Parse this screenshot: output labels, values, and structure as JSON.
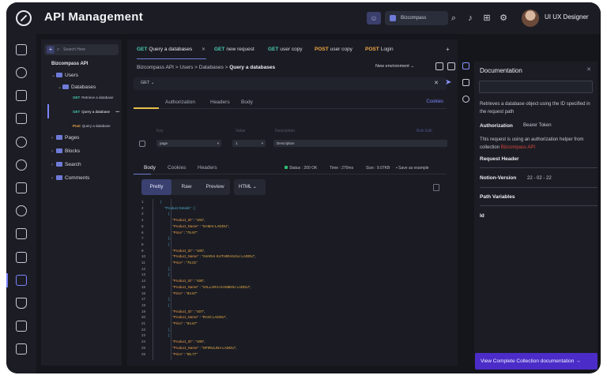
{
  "topbar": {
    "title": "API Management",
    "workspace": "Bizcompass",
    "user_name": "UI UX Designer",
    "icons": [
      "team-icon",
      "search-icon",
      "bell-icon",
      "apps-icon",
      "settings-icon"
    ]
  },
  "leftnav": {
    "items": [
      "compass-icon",
      "home-icon",
      "user-icon",
      "briefcase-icon",
      "cards-icon",
      "add-user-icon",
      "user-settings-icon",
      "grid-icon",
      "gear-icon",
      "chart-icon",
      "id-card-icon",
      "api-icon",
      "trophy-icon",
      "monitor-icon",
      "logout-icon"
    ],
    "active_index": 11,
    "accent": "#7b84ff"
  },
  "tree": {
    "search_placeholder": "Search Here",
    "root": "Bizcompass API",
    "users": "Users",
    "databases": "Databases",
    "requests": [
      {
        "method": "GET",
        "label": "Retrieve a database",
        "more": ""
      },
      {
        "method": "GET",
        "label": "Query a database",
        "more": "•••"
      },
      {
        "method": "Post",
        "label": "Query a database",
        "more": ""
      }
    ],
    "folders": [
      "Pages",
      "Blocks",
      "Search",
      "Comments"
    ]
  },
  "tabs": [
    {
      "method": "GET",
      "label": "Query a databases",
      "close": "✕"
    },
    {
      "method": "GET",
      "label": "new request"
    },
    {
      "method": "GET",
      "label": "user copy"
    },
    {
      "method": "POST",
      "label": "user copy"
    },
    {
      "method": "POST",
      "label": "Login"
    }
  ],
  "tab_actions": {
    "plus": "+",
    "more": "•••"
  },
  "breadcrumb": {
    "path": "Bizcompass API > Users > Databases > ",
    "current": "Query a databases"
  },
  "environment": "New environment",
  "url": {
    "method": "GET"
  },
  "request_tabs": [
    "Authorization",
    "Headers",
    "Body"
  ],
  "request_link": "Cookies",
  "params": {
    "headers": [
      "Key",
      "Value",
      "Description"
    ],
    "bulk_edit": "Bulk Edit",
    "row": {
      "key": "page",
      "value": "1",
      "description": "Description"
    }
  },
  "response": {
    "tabs": [
      "Body",
      "Cookies",
      "Headers"
    ],
    "status": "Status : 200 OK",
    "time": "Time : 270ms",
    "size": "Size : 9.07KB",
    "save": "Save as example",
    "views": [
      "Pretty",
      "Raw",
      "Preview"
    ],
    "format": "HTML"
  },
  "code": {
    "lines": [
      {
        "n": "1",
        "text": "{"
      },
      {
        "n": "2",
        "text": "    \"Product Details\" : ["
      },
      {
        "n": "3",
        "text": "        {"
      },
      {
        "n": "4",
        "text": "            \"Product_ID\" : \"404\","
      },
      {
        "n": "5",
        "text": "            \"Product_Name\" : \"SAMAI LADDU\","
      },
      {
        "n": "6",
        "text": "            \"Price\" : \"75.97\""
      },
      {
        "n": "7",
        "text": "        },"
      },
      {
        "n": "8",
        "text": "        {"
      },
      {
        "n": "9",
        "text": "            \"Product_ID\" : \"405\","
      },
      {
        "n": "10",
        "text": "            \"Product_Name\" : \"AVARAI KUTHIRAIVALI LADDU\","
      },
      {
        "n": "11",
        "text": "            \"Price\" : \"75.01\""
      },
      {
        "n": "12",
        "text": "        },"
      },
      {
        "n": "13",
        "text": "        {"
      },
      {
        "n": "14",
        "text": "            \"Product_ID\" : \"406\","
      },
      {
        "n": "15",
        "text": "            \"Product_Name\" : \"VALLARAI KAMBHU LADDU\","
      },
      {
        "n": "16",
        "text": "            \"Price\" : \"84.67\""
      },
      {
        "n": "17",
        "text": "        },"
      },
      {
        "n": "18",
        "text": "        {"
      },
      {
        "n": "19",
        "text": "            \"Product_ID\" : \"407\","
      },
      {
        "n": "20",
        "text": "            \"Product_Name\" : \"RAGI LADDU\","
      },
      {
        "n": "21",
        "text": "            \"Price\" : \"84.67\""
      },
      {
        "n": "22",
        "text": "        },"
      },
      {
        "n": "23",
        "text": "        {"
      },
      {
        "n": "24",
        "text": "            \"Product_ID\" : \"408\","
      },
      {
        "n": "25",
        "text": "            \"Product_Name\" : \"SPIRULINA LADDU\","
      },
      {
        "n": "26",
        "text": "            \"Price\" : \"85.77\""
      }
    ]
  },
  "doc": {
    "title": "Documentation",
    "close": "✕",
    "description": "Retrieves a database object using the ID specified in the request path",
    "auth_label": "Authorization",
    "auth_value": "Bearer Token",
    "note": "This request is using an authorization helper from collection",
    "note_link": "Bizcompass API",
    "header_label": "Request Header",
    "version_label": "Notion-Version",
    "version_value": "22 - 02 - 22",
    "path_vars": "Path Variables",
    "id_label": "Id",
    "cta": "View Complete Collection documentation →"
  },
  "colors": {
    "get": "#48c9b0",
    "post": "#f0a646",
    "accent": "#6f7bd8",
    "cta": "#4b2cc8"
  }
}
